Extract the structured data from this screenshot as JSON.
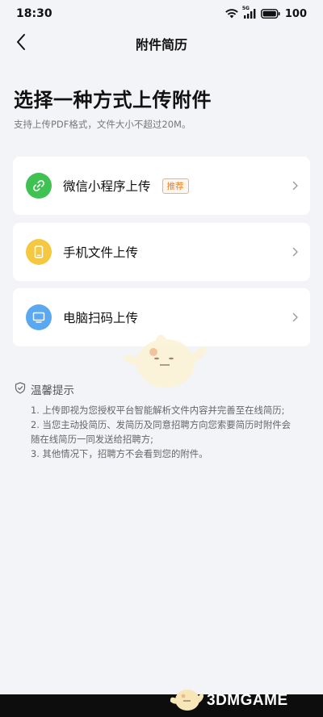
{
  "status_bar": {
    "time": "18:30",
    "battery": "100",
    "network_label": "5G"
  },
  "nav": {
    "title": "附件简历",
    "back_icon": "chevron-left-icon"
  },
  "main": {
    "heading": "选择一种方式上传附件",
    "subtitle": "支持上传PDF格式，文件大小不超过20M。",
    "options": [
      {
        "label": "微信小程序上传",
        "badge": "推荐",
        "icon": "link-icon",
        "icon_bg": "#3fc251"
      },
      {
        "label": "手机文件上传",
        "badge": "",
        "icon": "phone-icon",
        "icon_bg": "#f5c842"
      },
      {
        "label": "电脑扫码上传",
        "badge": "",
        "icon": "monitor-icon",
        "icon_bg": "#5aa8f0"
      }
    ]
  },
  "tips": {
    "title": "温馨提示",
    "items": [
      "1. 上传即视为您授权平台智能解析文件内容并完善至在线简历;",
      "2. 当您主动投简历、发简历及同意招聘方向您索要简历时附件会",
      "随在线简历一同发送给招聘方;",
      "3. 其他情况下，招聘方不会看到您的附件。"
    ]
  },
  "watermark": {
    "text": "3DMGAME"
  },
  "colors": {
    "background": "#f3f4f8",
    "badge_orange": "#e8822a",
    "green": "#3fc251",
    "yellow": "#f5c842",
    "blue": "#5aa8f0"
  }
}
